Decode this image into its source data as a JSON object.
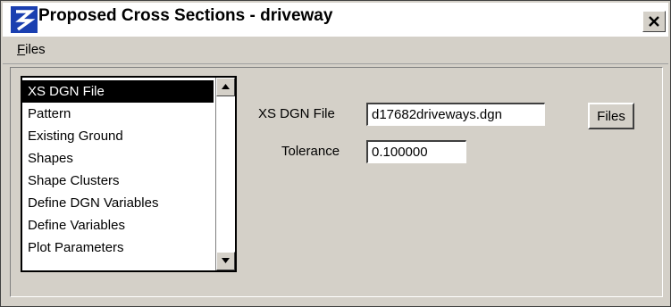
{
  "window": {
    "title": "Proposed Cross Sections - driveway",
    "icon": "app-logo-icon",
    "close_icon": "close-icon"
  },
  "menu": {
    "files_accel": "F",
    "files_rest": "iles"
  },
  "list": {
    "selected_index": 0,
    "items": [
      "XS DGN File",
      "Pattern",
      "Existing Ground",
      "Shapes",
      "Shape Clusters",
      "Define DGN Variables",
      "Define Variables",
      "Plot Parameters"
    ]
  },
  "form": {
    "xs_dgn_label": "XS DGN File",
    "xs_dgn_value": "d17682driveways.dgn",
    "files_button": "Files",
    "tolerance_label": "Tolerance",
    "tolerance_value": "0.100000"
  }
}
